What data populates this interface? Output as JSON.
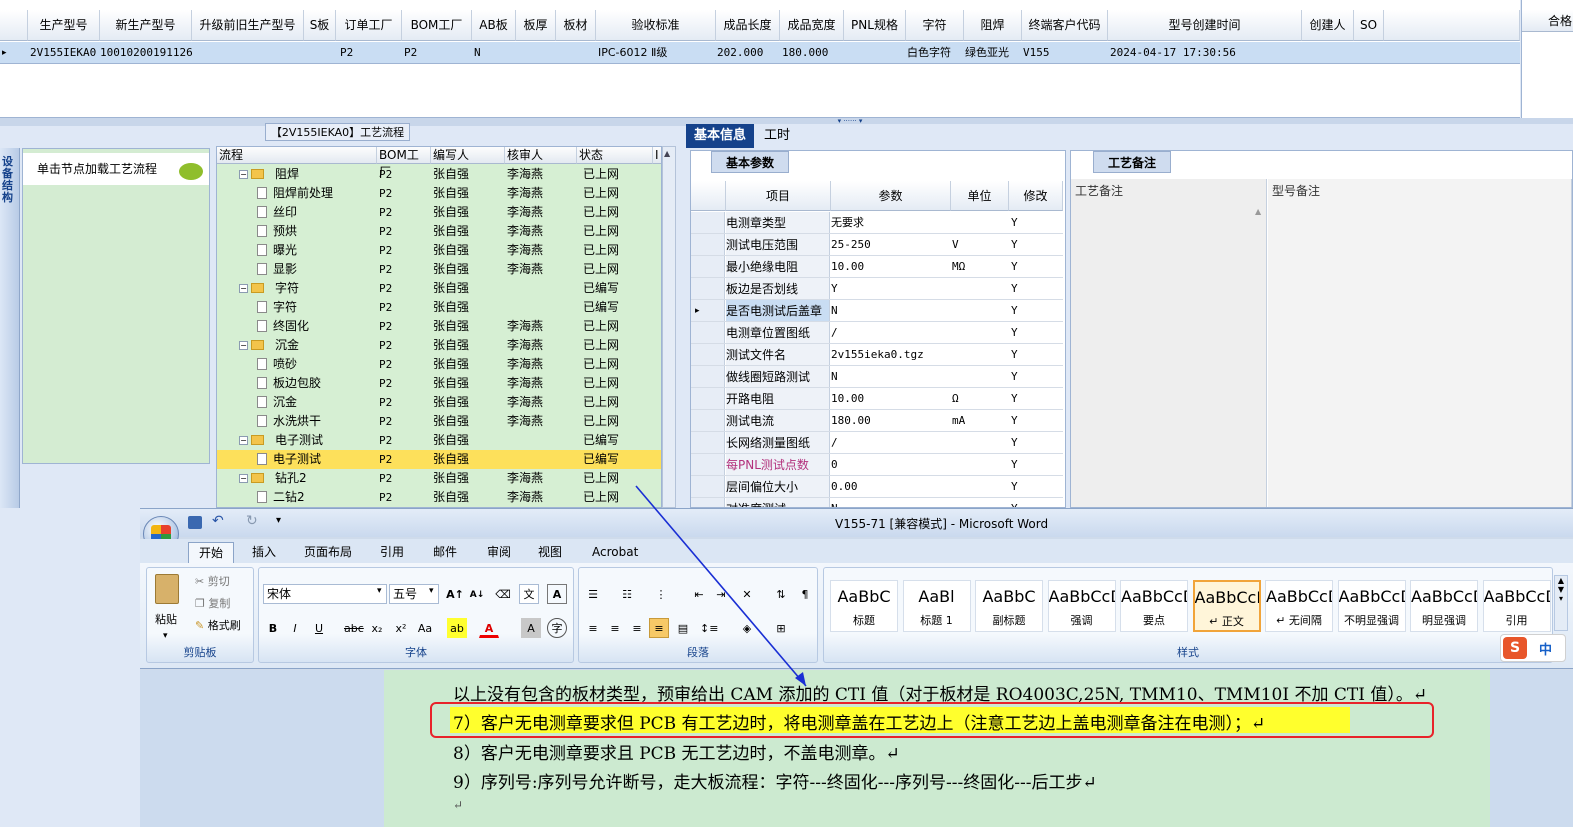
{
  "top_grid": {
    "headers": [
      "生产型号",
      "新生产型号",
      "升级前旧生产型号",
      "S板",
      "订单工厂",
      "BOM工厂",
      "AB板",
      "板厚",
      "板材",
      "验收标准",
      "成品长度",
      "成品宽度",
      "PNL规格",
      "字符",
      "阻焊",
      "终端客户代码",
      "型号创建时间",
      "创建人",
      "SO"
    ],
    "row": {
      "model": "2V155IEKA0",
      "new_model": "10010200191126",
      "order_factory": "P2",
      "bom_factory": "P2",
      "ab": "N",
      "standard": "IPC-6012 Ⅱ级",
      "length": "202.000",
      "width": "180.000",
      "char": "白色字符",
      "mask": "绿色亚光",
      "customer": "V155",
      "created": "2024-04-17 17:30:56"
    },
    "right_header": "合格"
  },
  "left_strip_text": "设备结构",
  "process_title": "【2V155IEKA0】工艺流程",
  "hint": "单击节点加载工艺流程",
  "tree": {
    "headers": [
      "流程",
      "BOM工厂",
      "编写人",
      "核审人",
      "状态",
      "I"
    ],
    "rows": [
      {
        "level": 0,
        "name": "阻焊",
        "bom": "P2",
        "writer": "张自强",
        "reviewer": "李海燕",
        "status": "已上网"
      },
      {
        "level": 1,
        "name": "阻焊前处理",
        "bom": "P2",
        "writer": "张自强",
        "reviewer": "李海燕",
        "status": "已上网"
      },
      {
        "level": 1,
        "name": "丝印",
        "bom": "P2",
        "writer": "张自强",
        "reviewer": "李海燕",
        "status": "已上网"
      },
      {
        "level": 1,
        "name": "预烘",
        "bom": "P2",
        "writer": "张自强",
        "reviewer": "李海燕",
        "status": "已上网"
      },
      {
        "level": 1,
        "name": "曝光",
        "bom": "P2",
        "writer": "张自强",
        "reviewer": "李海燕",
        "status": "已上网"
      },
      {
        "level": 1,
        "name": "显影",
        "bom": "P2",
        "writer": "张自强",
        "reviewer": "李海燕",
        "status": "已上网"
      },
      {
        "level": 0,
        "name": "字符",
        "bom": "P2",
        "writer": "张自强",
        "reviewer": "",
        "status": "已编写"
      },
      {
        "level": 1,
        "name": "字符",
        "bom": "P2",
        "writer": "张自强",
        "reviewer": "",
        "status": "已编写"
      },
      {
        "level": 1,
        "name": "终固化",
        "bom": "P2",
        "writer": "张自强",
        "reviewer": "李海燕",
        "status": "已上网"
      },
      {
        "level": 0,
        "name": "沉金",
        "bom": "P2",
        "writer": "张自强",
        "reviewer": "李海燕",
        "status": "已上网"
      },
      {
        "level": 1,
        "name": "喷砂",
        "bom": "P2",
        "writer": "张自强",
        "reviewer": "李海燕",
        "status": "已上网"
      },
      {
        "level": 1,
        "name": "板边包胶",
        "bom": "P2",
        "writer": "张自强",
        "reviewer": "李海燕",
        "status": "已上网"
      },
      {
        "level": 1,
        "name": "沉金",
        "bom": "P2",
        "writer": "张自强",
        "reviewer": "李海燕",
        "status": "已上网"
      },
      {
        "level": 1,
        "name": "水洗烘干",
        "bom": "P2",
        "writer": "张自强",
        "reviewer": "李海燕",
        "status": "已上网"
      },
      {
        "level": 0,
        "name": "电子测试",
        "bom": "P2",
        "writer": "张自强",
        "reviewer": "",
        "status": "已编写"
      },
      {
        "level": 1,
        "name": "电子测试",
        "bom": "P2",
        "writer": "张自强",
        "reviewer": "",
        "status": "已编写",
        "selected": true
      },
      {
        "level": 0,
        "name": "钻孔2",
        "bom": "P2",
        "writer": "张自强",
        "reviewer": "李海燕",
        "status": "已上网"
      },
      {
        "level": 1,
        "name": "二钻2",
        "bom": "P2",
        "writer": "张自强",
        "reviewer": "李海燕",
        "status": "已上网"
      }
    ]
  },
  "tabs": [
    "基本信息",
    "工时"
  ],
  "basic": {
    "caption": "基本参数",
    "headers": [
      "项目",
      "参数",
      "单位",
      "修改"
    ],
    "rows": [
      {
        "item": "电测章类型",
        "param": "无要求",
        "unit": "",
        "mod": "Y"
      },
      {
        "item": "测试电压范围",
        "param": "25-250",
        "unit": "V",
        "mod": "Y"
      },
      {
        "item": "最小绝缘电阻",
        "param": "10.00",
        "unit": "MΩ",
        "mod": "Y"
      },
      {
        "item": "板边是否划线",
        "param": "Y",
        "unit": "",
        "mod": "Y"
      },
      {
        "item": "是否电测试后盖章",
        "param": "N",
        "unit": "",
        "mod": "Y"
      },
      {
        "item": "电测章位置图纸",
        "param": "/",
        "unit": "",
        "mod": "Y"
      },
      {
        "item": "测试文件名",
        "param": "2v155ieka0.tgz",
        "unit": "",
        "mod": "Y"
      },
      {
        "item": "做线圈短路测试",
        "param": "N",
        "unit": "",
        "mod": "Y"
      },
      {
        "item": "开路电阻",
        "param": "10.00",
        "unit": "Ω",
        "mod": "Y"
      },
      {
        "item": "测试电流",
        "param": "180.00",
        "unit": "mA",
        "mod": "Y"
      },
      {
        "item": "长网络测量图纸",
        "param": "/",
        "unit": "",
        "mod": "Y"
      },
      {
        "item": "每PNL测试点数",
        "param": "0",
        "unit": "",
        "mod": "Y"
      },
      {
        "item": "层间偏位大小",
        "param": "0.00",
        "unit": "",
        "mod": "Y"
      },
      {
        "item": "对准度测试",
        "param": "N",
        "unit": "",
        "mod": "Y"
      }
    ]
  },
  "remarks": {
    "caption": "工艺备注",
    "col1": "工艺备注",
    "col2": "型号备注"
  },
  "word": {
    "title": "V155-71 [兼容模式] - Microsoft Word",
    "tabs": [
      "开始",
      "插入",
      "页面布局",
      "引用",
      "邮件",
      "审阅",
      "视图",
      "Acrobat"
    ],
    "clipboard": {
      "paste": "粘贴",
      "cut": "剪切",
      "copy": "复制",
      "format": "格式刷",
      "label": "剪贴板"
    },
    "font": {
      "name": "宋体",
      "size": "五号",
      "label": "字体"
    },
    "paragraph_label": "段落",
    "styles_label": "样式",
    "styles": [
      {
        "preview": "AaBbC",
        "name": "标题"
      },
      {
        "preview": "AaBl",
        "name": "标题 1"
      },
      {
        "preview": "AaBbC",
        "name": "副标题"
      },
      {
        "preview": "AaBbCcDd",
        "name": "强调"
      },
      {
        "preview": "AaBbCcD",
        "name": "要点"
      },
      {
        "preview": "AaBbCcDd",
        "name": "↵ 正文"
      },
      {
        "preview": "AaBbCcDd",
        "name": "↵ 无间隔"
      },
      {
        "preview": "AaBbCcDd",
        "name": "不明显强调"
      },
      {
        "preview": "AaBbCcDd",
        "name": "明显强调"
      },
      {
        "preview": "AaBbCcDd",
        "name": "引用"
      }
    ],
    "paragraphs": [
      "以上没有包含的板材类型，预审给出 CAM 添加的 CTI 值（对于板材是 RO4003C,25N, TMM10、TMM10I 不加 CTI 值）。↵",
      "7）客户无电测章要求但 PCB 有工艺边时，将电测章盖在工艺边上（注意工艺边上盖电测章备注在电测）；↵",
      "8）客户无电测章要求且 PCB 无工艺边时，不盖电测章。↵",
      "9）序列号:序列号允许断号，走大板流程：字符---终固化---序列号---终固化---后工步↵",
      "↵"
    ],
    "sogou": "中"
  }
}
